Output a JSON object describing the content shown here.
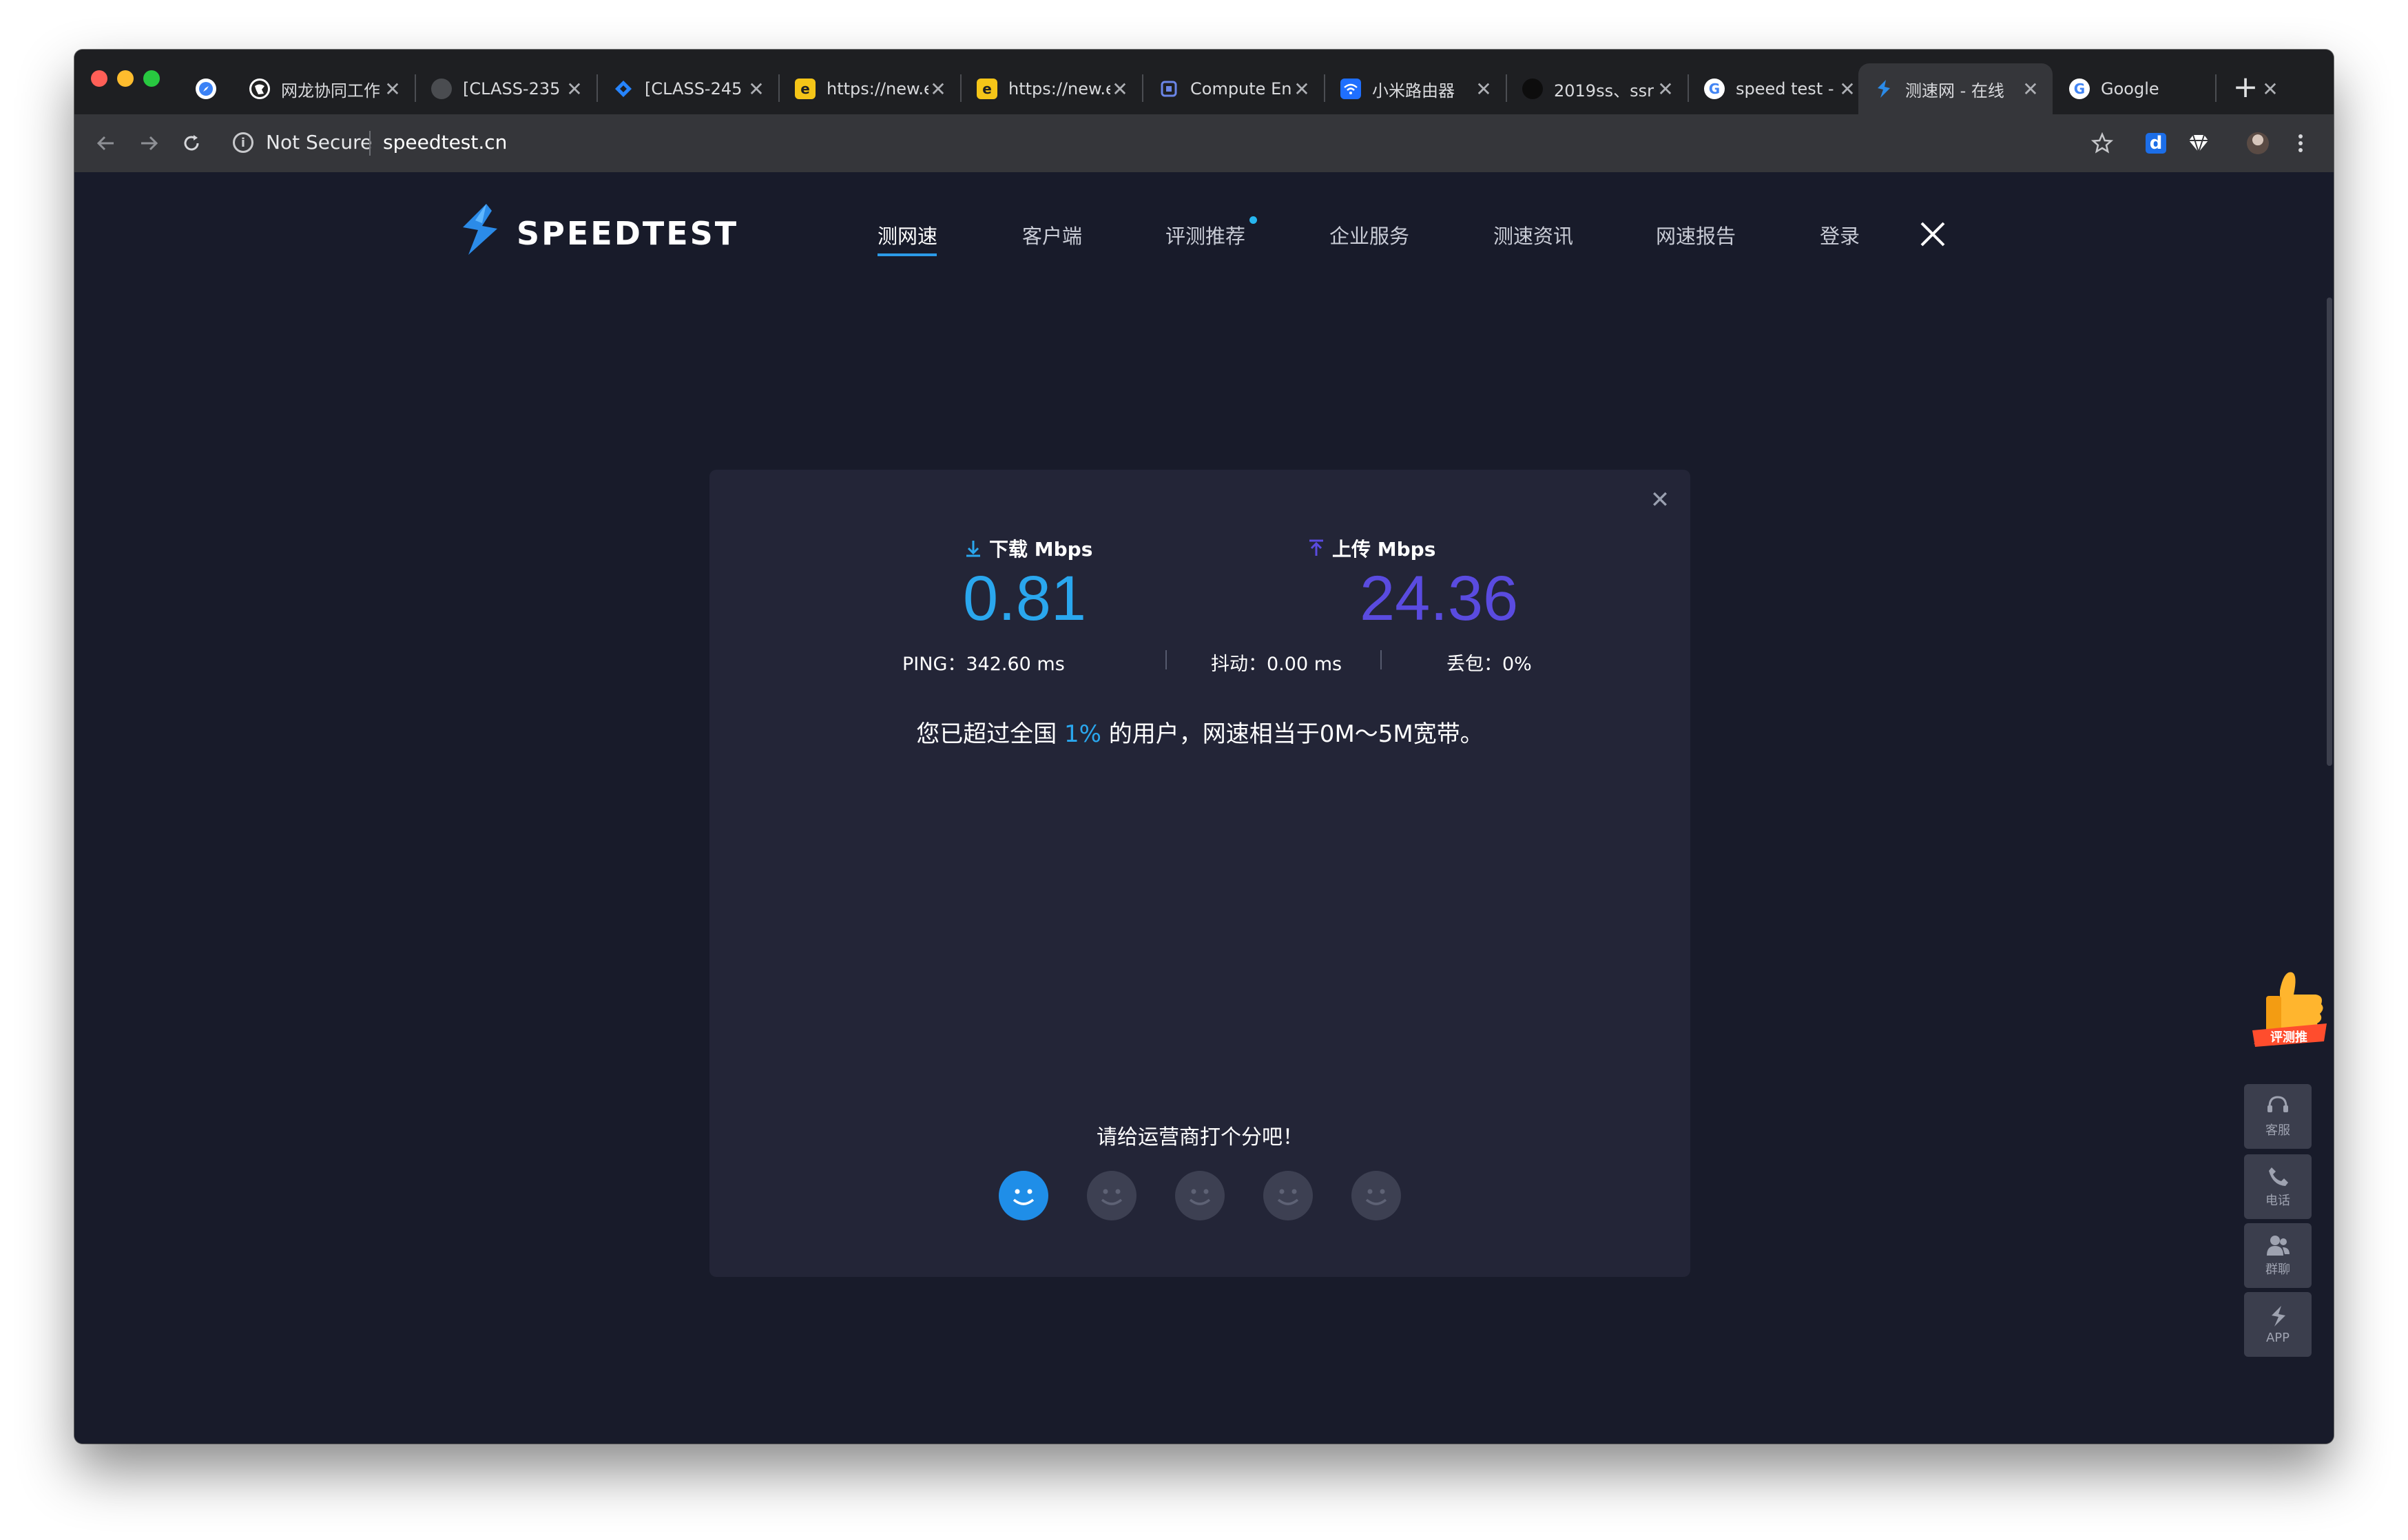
{
  "browser": {
    "tabs": [
      {
        "title": "",
        "favicon": "compass-icon",
        "color": "#ffffff"
      },
      {
        "title": "网龙协同工作",
        "favicon": "globe-icon",
        "color": "#ffffff"
      },
      {
        "title": "[CLASS-235",
        "favicon": "globe-icon",
        "color": "#4a4c50"
      },
      {
        "title": "[CLASS-245",
        "favicon": "jira-icon",
        "color": "#2684ff"
      },
      {
        "title": "https://new.e",
        "favicon": "e-icon",
        "color": "#f5c518"
      },
      {
        "title": "https://new.e",
        "favicon": "e-icon",
        "color": "#f5c518"
      },
      {
        "title": "Compute Eng",
        "favicon": "chip-icon",
        "color": "#4f6fd6"
      },
      {
        "title": "小米路由器",
        "favicon": "wifi-icon",
        "color": "#1f6fff"
      },
      {
        "title": "2019ss、ssr",
        "favicon": "github-icon",
        "color": "#000000"
      },
      {
        "title": "speed test -",
        "favicon": "google-icon",
        "color": "#ffffff"
      },
      {
        "title": "测速网 - 在线",
        "favicon": "speedtest-icon",
        "color": "#2b8be8"
      },
      {
        "title": "Google",
        "favicon": "google-icon",
        "color": "#ffffff"
      }
    ],
    "new_tab_symbol": "+",
    "close_symbol": "✕",
    "security_label": "Not Secure",
    "url": "speedtest.cn"
  },
  "site": {
    "logo_text": "SPEEDTEST",
    "nav": [
      "测网速",
      "客户端",
      "评测推荐",
      "企业服务",
      "测速资讯",
      "网速报告",
      "登录"
    ],
    "active_nav": "测网速"
  },
  "result": {
    "download_label": "下载 Mbps",
    "download_value": "0.81",
    "download_color": "#2aa7ee",
    "upload_label": "上传 Mbps",
    "upload_value": "24.36",
    "upload_color": "#5a4be0",
    "ping_label": "PING：",
    "ping_value": "342.60 ms",
    "jitter_label": "抖动：",
    "jitter_value": "0.00 ms",
    "loss_label": "丢包：",
    "loss_value": "0%",
    "summary_prefix": "您已超过全国 ",
    "summary_pct": "1%",
    "summary_suffix": " 的用户，网速相当于0M～5M宽带。",
    "rating_prompt": "请给运营商打个分吧！",
    "rating_selected_index": 0,
    "close_symbol": "✕"
  },
  "side": {
    "badge_text": "评测推",
    "buttons": [
      {
        "label": "客服",
        "icon": "headset-icon"
      },
      {
        "label": "电话",
        "icon": "phone-icon"
      },
      {
        "label": "群聊",
        "icon": "group-icon"
      },
      {
        "label": "APP",
        "icon": "speedtest-icon"
      }
    ]
  }
}
